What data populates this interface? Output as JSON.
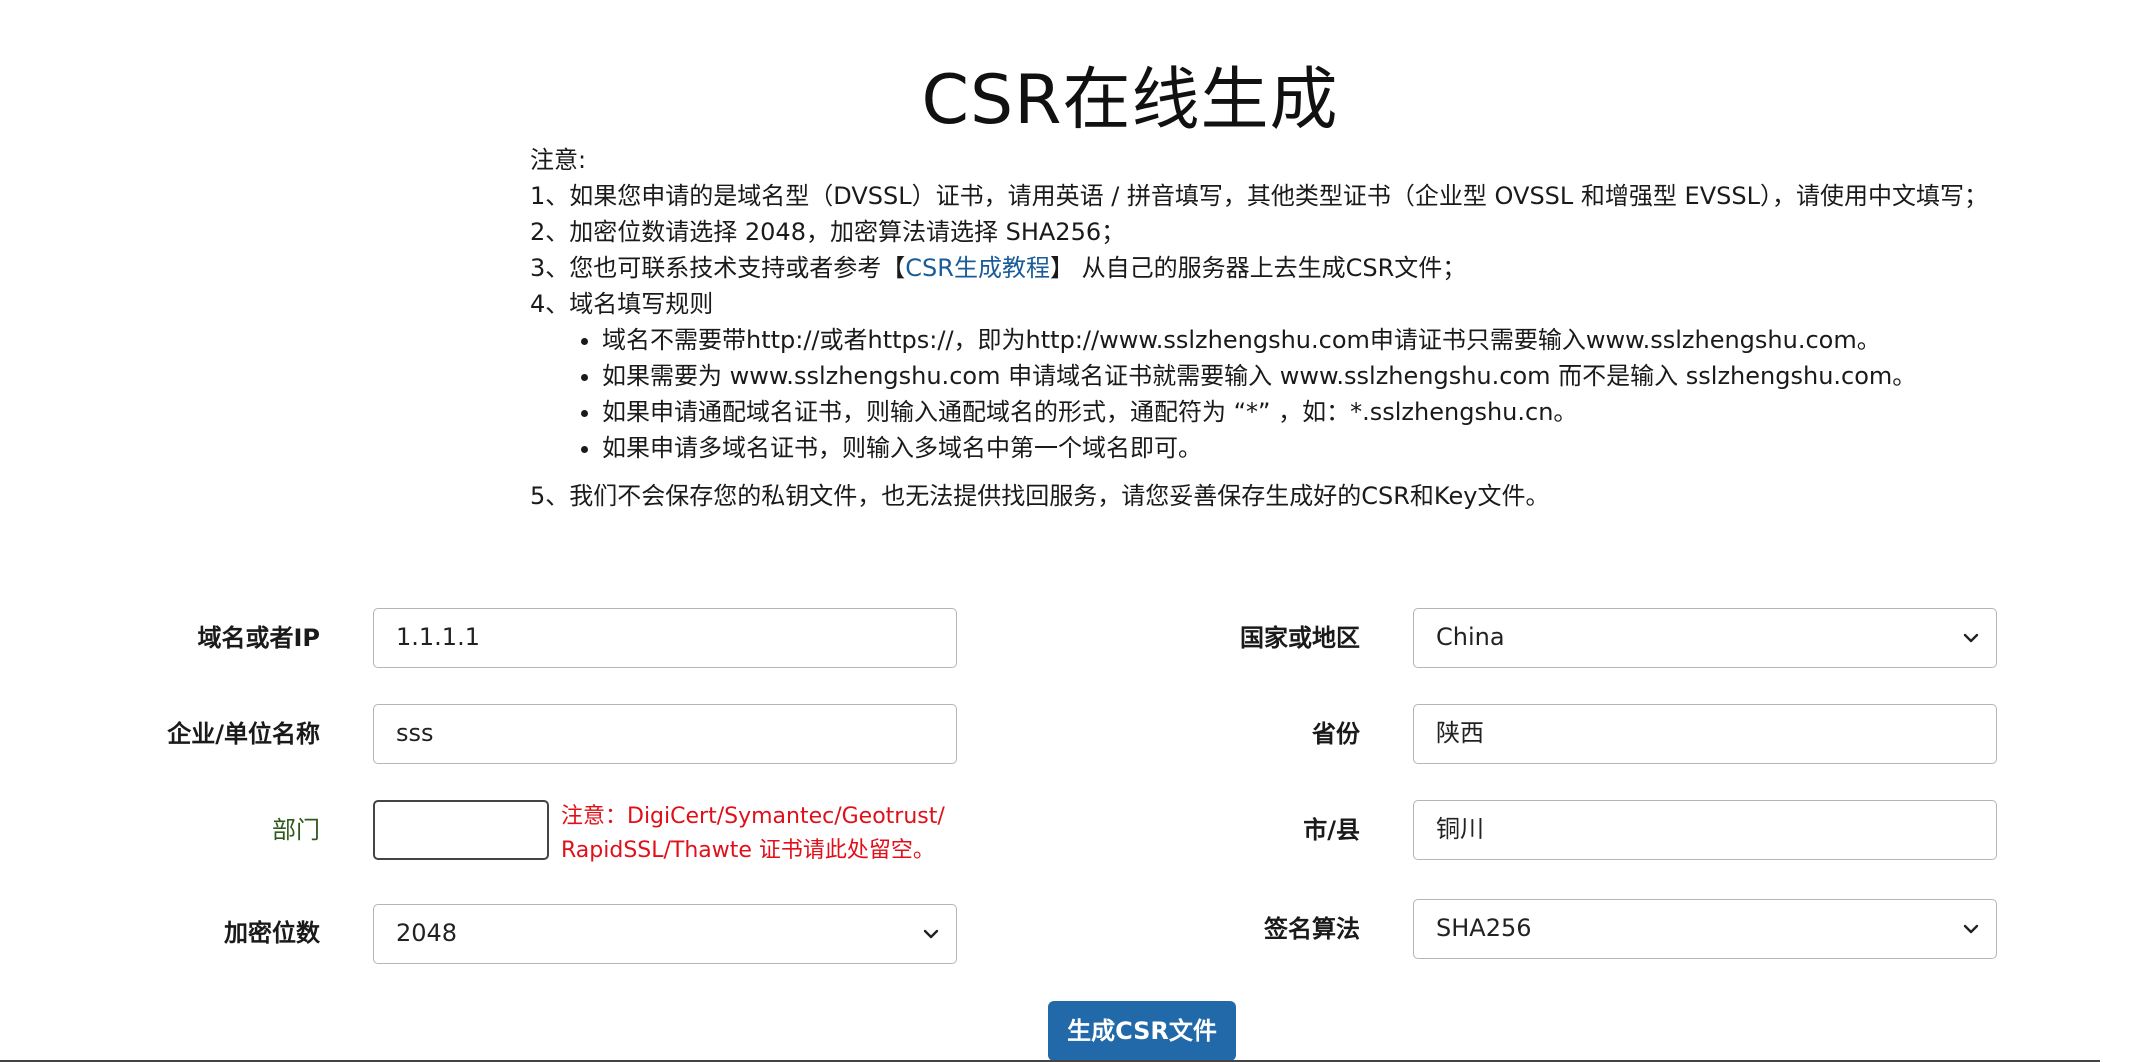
{
  "page": {
    "title": "CSR在线生成"
  },
  "notice": {
    "heading": "注意:",
    "item1": "1、如果您申请的是域名型（DVSSL）证书，请用英语 / 拼音填写，其他类型证书（企业型 OVSSL 和增强型 EVSSL），请使用中文填写；",
    "item2": "2、加密位数请选择 2048，加密算法请选择 SHA256；",
    "item3_prefix": "3、您也可联系技术支持或者参考【",
    "item3_link": "CSR生成教程",
    "item3_suffix": "】 从自己的服务器上去生成CSR文件；",
    "item4": "4、域名填写规则",
    "rules": [
      "域名不需要带http://或者https://，即为http://www.sslzhengshu.com申请证书只需要输入www.sslzhengshu.com。",
      "如果需要为 www.sslzhengshu.com 申请域名证书就需要输入 www.sslzhengshu.com 而不是输入 sslzhengshu.com。",
      "如果申请通配域名证书，则输入通配域名的形式，通配符为 “*” ，如：*.sslzhengshu.cn。",
      "如果申请多域名证书，则输入多域名中第一个域名即可。"
    ],
    "item5": "5、我们不会保存您的私钥文件，也无法提供找回服务，请您妥善保存生成好的CSR和Key文件。"
  },
  "form": {
    "domain": {
      "label": "域名或者IP",
      "value": "1.1.1.1"
    },
    "org": {
      "label": "企业/单位名称",
      "value": "sss"
    },
    "dept": {
      "label": "部门",
      "value": "",
      "note_line1": "注意：DigiCert/Symantec/Geotrust/",
      "note_line2": "RapidSSL/Thawte 证书请此处留空。"
    },
    "key_bits": {
      "label": "加密位数",
      "value": "2048"
    },
    "country": {
      "label": "国家或地区",
      "value": "China"
    },
    "province": {
      "label": "省份",
      "value": "陕西"
    },
    "city": {
      "label": "市/县",
      "value": "铜川"
    },
    "sig_alg": {
      "label": "签名算法",
      "value": "SHA256"
    },
    "submit_label": "生成CSR文件"
  },
  "colors": {
    "accent": "#2169a8",
    "link": "#1a5c99",
    "warning": "#e0101a",
    "dept_label": "#2e5a1c"
  },
  "icons": {
    "select_arrow": "chevron-down-icon"
  }
}
